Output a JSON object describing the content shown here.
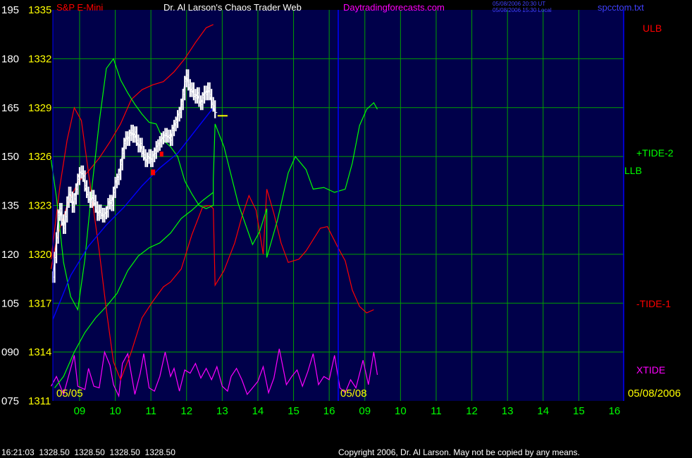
{
  "header": {
    "instrument": "S&P E-Mini",
    "title": "Dr. Al Larson's Chaos Trader Web",
    "site": "Daytradingforecasts.com",
    "timestamp_ut": "05/08/2006 20:30 UT",
    "timestamp_local": "05/08/2006 15:30 Local",
    "file": "spcctom.txt"
  },
  "footer": {
    "readout": "16:21:03  1328.50  1328.50  1328.50  1328.50",
    "copyright": "Copyright 2006, Dr. Al Larson. May not be copied by any means."
  },
  "colors": {
    "background": "#000000",
    "plot_bg": "#00004a",
    "grid": "#00a000",
    "price_axis": "#ffff00",
    "left_axis": "#ffffff",
    "hour_labels": "#00ff00",
    "date_labels": "#ffff00",
    "title": "#ffffff",
    "site": "#ff00ff",
    "instrument": "#ff0000",
    "file": "#4040ff",
    "ulb": "#ff0000",
    "llb": "#00ff00",
    "tide_plus": "#00ff00",
    "tide_minus": "#ff0000",
    "xtide": "#ff00ff",
    "ma": "#0000ff",
    "price_bars": "#ffffff",
    "divider": "#0000ff"
  },
  "chart_data": {
    "type": "line",
    "left_axis_ticks": [
      "195",
      "180",
      "165",
      "150",
      "135",
      "120",
      "105",
      "090",
      "075"
    ],
    "price_axis_ticks": [
      "1335",
      "1332",
      "1329",
      "1326",
      "1323",
      "1320",
      "1317",
      "1314",
      "1311"
    ],
    "x_hour_labels": [
      "09",
      "10",
      "11",
      "12",
      "13",
      "14",
      "15",
      "16",
      "09",
      "10",
      "11",
      "12",
      "13",
      "14",
      "15",
      "16"
    ],
    "date_labels": [
      "05/05",
      "05/08",
      "05/08/2006"
    ],
    "price_ylim": [
      1311,
      1335
    ],
    "series_labels": {
      "ulb": "ULB",
      "llb": "LLB",
      "tide_plus": "+TIDE-2",
      "tide_minus": "-TIDE-1",
      "xtide": "XTIDE"
    },
    "price_line": [
      [
        0,
        1318.6
      ],
      [
        0.05,
        1319.8
      ],
      [
        0.1,
        1321.0
      ],
      [
        0.15,
        1322.4
      ],
      [
        0.2,
        1322.8
      ],
      [
        0.25,
        1322.1
      ],
      [
        0.3,
        1321.6
      ],
      [
        0.35,
        1322.3
      ],
      [
        0.4,
        1323.2
      ],
      [
        0.45,
        1323.8
      ],
      [
        0.5,
        1323.5
      ],
      [
        0.55,
        1322.9
      ],
      [
        0.6,
        1323.4
      ],
      [
        0.65,
        1324.0
      ],
      [
        0.7,
        1324.6
      ],
      [
        0.75,
        1325.0
      ],
      [
        0.8,
        1325.1
      ],
      [
        0.85,
        1324.8
      ],
      [
        0.9,
        1324.2
      ],
      [
        0.95,
        1323.8
      ],
      [
        1.0,
        1323.5
      ],
      [
        1.05,
        1323.2
      ],
      [
        1.1,
        1323.6
      ],
      [
        1.15,
        1323.3
      ],
      [
        1.2,
        1322.9
      ],
      [
        1.25,
        1322.4
      ],
      [
        1.3,
        1322.7
      ],
      [
        1.35,
        1322.5
      ],
      [
        1.4,
        1322.3
      ],
      [
        1.45,
        1322.5
      ],
      [
        1.5,
        1322.6
      ],
      [
        1.55,
        1323.1
      ],
      [
        1.6,
        1323.3
      ],
      [
        1.65,
        1323.0
      ],
      [
        1.7,
        1323.8
      ],
      [
        1.75,
        1324.4
      ],
      [
        1.8,
        1324.6
      ],
      [
        1.85,
        1324.9
      ],
      [
        1.9,
        1325.5
      ],
      [
        1.95,
        1326.2
      ],
      [
        2.0,
        1326.8
      ],
      [
        2.05,
        1327.2
      ],
      [
        2.1,
        1327.0
      ],
      [
        2.15,
        1327.3
      ],
      [
        2.2,
        1327.6
      ],
      [
        2.25,
        1327.2
      ],
      [
        2.3,
        1327.5
      ],
      [
        2.35,
        1327.0
      ],
      [
        2.4,
        1326.6
      ],
      [
        2.45,
        1326.8
      ],
      [
        2.5,
        1326.3
      ],
      [
        2.55,
        1326.1
      ],
      [
        2.6,
        1325.7
      ],
      [
        2.65,
        1325.9
      ],
      [
        2.7,
        1326.1
      ],
      [
        2.75,
        1325.7
      ],
      [
        2.8,
        1326.0
      ],
      [
        2.85,
        1326.2
      ],
      [
        2.9,
        1326.6
      ],
      [
        2.95,
        1326.7
      ],
      [
        3.0,
        1326.9
      ],
      [
        3.05,
        1327.1
      ],
      [
        3.1,
        1327.2
      ],
      [
        3.15,
        1327.4
      ],
      [
        3.2,
        1327.2
      ],
      [
        3.25,
        1327.3
      ],
      [
        3.3,
        1327.0
      ],
      [
        3.35,
        1327.6
      ],
      [
        3.4,
        1327.9
      ],
      [
        3.45,
        1328.1
      ],
      [
        3.5,
        1328.5
      ],
      [
        3.55,
        1328.7
      ],
      [
        3.6,
        1329.2
      ],
      [
        3.65,
        1329.8
      ],
      [
        3.7,
        1330.6
      ],
      [
        3.75,
        1331.0
      ],
      [
        3.8,
        1330.4
      ],
      [
        3.85,
        1330.0
      ],
      [
        3.9,
        1330.2
      ],
      [
        3.95,
        1329.8
      ],
      [
        4.0,
        1329.6
      ],
      [
        4.05,
        1329.9
      ],
      [
        4.1,
        1329.4
      ],
      [
        4.15,
        1329.2
      ],
      [
        4.2,
        1329.6
      ],
      [
        4.25,
        1330.0
      ],
      [
        4.3,
        1329.8
      ],
      [
        4.35,
        1330.2
      ],
      [
        4.4,
        1329.8
      ],
      [
        4.45,
        1329.3
      ],
      [
        4.5,
        1329.1
      ],
      [
        4.55,
        1328.7
      ]
    ],
    "ma_line": [
      [
        0,
        1316.0
      ],
      [
        0.5,
        1318.7
      ],
      [
        1.0,
        1320.5
      ],
      [
        1.5,
        1321.8
      ],
      [
        2.0,
        1322.9
      ],
      [
        2.5,
        1324.2
      ],
      [
        3.0,
        1325.3
      ],
      [
        3.5,
        1326.2
      ],
      [
        4.0,
        1327.6
      ],
      [
        4.5,
        1329.0
      ]
    ],
    "ulb": [
      [
        -0.05,
        1319.1
      ],
      [
        0.1,
        1320.9
      ],
      [
        0.4,
        1323.0
      ],
      [
        0.7,
        1324.4
      ],
      [
        1.0,
        1325.1
      ],
      [
        1.3,
        1325.9
      ],
      [
        1.6,
        1326.9
      ],
      [
        1.9,
        1328.0
      ],
      [
        2.2,
        1329.5
      ],
      [
        2.5,
        1330.1
      ],
      [
        2.8,
        1330.4
      ],
      [
        3.1,
        1330.6
      ],
      [
        3.4,
        1331.2
      ],
      [
        3.7,
        1332.0
      ],
      [
        4.0,
        1333.0
      ],
      [
        4.3,
        1333.9
      ],
      [
        4.5,
        1334.1
      ]
    ],
    "llb": [
      [
        0.05,
        1311.8
      ],
      [
        0.3,
        1312.5
      ],
      [
        0.6,
        1314.0
      ],
      [
        0.9,
        1315.2
      ],
      [
        1.2,
        1316.1
      ],
      [
        1.5,
        1316.8
      ],
      [
        1.8,
        1317.6
      ],
      [
        2.1,
        1319.0
      ],
      [
        2.4,
        1319.9
      ],
      [
        2.7,
        1320.4
      ],
      [
        3.0,
        1320.7
      ],
      [
        3.3,
        1321.3
      ],
      [
        3.6,
        1322.2
      ],
      [
        3.9,
        1322.7
      ],
      [
        4.2,
        1323.3
      ],
      [
        4.5,
        1323.8
      ]
    ],
    "tide_plus": [
      [
        -0.05,
        1325.8
      ],
      [
        0.1,
        1323.5
      ],
      [
        0.3,
        1319.5
      ],
      [
        0.5,
        1317.4
      ],
      [
        0.7,
        1316.6
      ],
      [
        0.9,
        1319.7
      ],
      [
        1.1,
        1324.2
      ],
      [
        1.3,
        1328.1
      ],
      [
        1.5,
        1331.4
      ],
      [
        1.7,
        1332.0
      ],
      [
        1.9,
        1330.7
      ],
      [
        2.1,
        1329.9
      ],
      [
        2.3,
        1329.2
      ],
      [
        2.5,
        1328.6
      ],
      [
        2.7,
        1328.1
      ],
      [
        2.9,
        1328.0
      ],
      [
        3.1,
        1327.0
      ],
      [
        3.3,
        1326.6
      ],
      [
        3.5,
        1326.0
      ],
      [
        3.7,
        1324.5
      ],
      [
        3.9,
        1323.7
      ],
      [
        4.1,
        1323.0
      ],
      [
        4.3,
        1322.8
      ],
      [
        4.5,
        1323.0
      ],
      [
        4.5,
        1324.6
      ],
      [
        4.55,
        1328.0
      ],
      [
        4.8,
        1326.6
      ],
      [
        5.2,
        1323.1
      ],
      [
        5.6,
        1320.6
      ],
      [
        5.8,
        1321.4
      ],
      [
        6.0,
        1322.8
      ],
      [
        6.0,
        1319.8
      ],
      [
        6.3,
        1322.1
      ],
      [
        6.6,
        1325.0
      ],
      [
        6.8,
        1326.0
      ],
      [
        7.1,
        1325.2
      ],
      [
        7.3,
        1324.0
      ],
      [
        7.6,
        1324.1
      ],
      [
        7.9,
        1323.8
      ],
      [
        8.2,
        1324.0
      ],
      [
        8.4,
        1325.6
      ],
      [
        8.6,
        1327.9
      ],
      [
        8.8,
        1328.9
      ],
      [
        9.0,
        1329.3
      ],
      [
        9.1,
        1328.9
      ]
    ],
    "tide_minus": [
      [
        -0.05,
        1319.7
      ],
      [
        0.2,
        1324.2
      ],
      [
        0.4,
        1327.0
      ],
      [
        0.6,
        1329.0
      ],
      [
        0.8,
        1328.2
      ],
      [
        1.0,
        1325.0
      ],
      [
        1.3,
        1320.2
      ],
      [
        1.5,
        1316.6
      ],
      [
        1.7,
        1313.4
      ],
      [
        1.9,
        1312.3
      ],
      [
        2.2,
        1314.0
      ],
      [
        2.5,
        1316.1
      ],
      [
        2.8,
        1317.1
      ],
      [
        3.1,
        1318.0
      ],
      [
        3.3,
        1318.3
      ],
      [
        3.6,
        1319.1
      ],
      [
        3.9,
        1321.2
      ],
      [
        4.2,
        1322.9
      ],
      [
        4.4,
        1323.0
      ],
      [
        4.5,
        1322.8
      ],
      [
        4.55,
        1318.1
      ],
      [
        4.8,
        1319.0
      ],
      [
        5.1,
        1320.7
      ],
      [
        5.3,
        1322.3
      ],
      [
        5.5,
        1323.6
      ],
      [
        5.7,
        1322.7
      ],
      [
        5.9,
        1320.0
      ],
      [
        6.0,
        1324.0
      ],
      [
        6.2,
        1322.5
      ],
      [
        6.4,
        1320.7
      ],
      [
        6.6,
        1319.5
      ],
      [
        6.9,
        1319.7
      ],
      [
        7.1,
        1320.2
      ],
      [
        7.3,
        1320.9
      ],
      [
        7.5,
        1321.6
      ],
      [
        7.7,
        1321.7
      ],
      [
        8.0,
        1320.4
      ],
      [
        8.2,
        1319.6
      ],
      [
        8.4,
        1317.8
      ],
      [
        8.6,
        1316.8
      ],
      [
        8.8,
        1316.4
      ],
      [
        9.0,
        1316.6
      ]
    ],
    "xtide": [
      [
        -0.05,
        1311.9
      ],
      [
        0.1,
        1312.5
      ],
      [
        0.3,
        1311.4
      ],
      [
        0.5,
        1313.0
      ],
      [
        0.6,
        1313.8
      ],
      [
        0.7,
        1311.9
      ],
      [
        0.9,
        1311.7
      ],
      [
        1.0,
        1313.0
      ],
      [
        1.15,
        1311.9
      ],
      [
        1.3,
        1311.8
      ],
      [
        1.45,
        1314.0
      ],
      [
        1.6,
        1313.2
      ],
      [
        1.7,
        1312.0
      ],
      [
        1.85,
        1311.3
      ],
      [
        1.95,
        1313.3
      ],
      [
        2.1,
        1313.9
      ],
      [
        2.3,
        1311.4
      ],
      [
        2.45,
        1312.7
      ],
      [
        2.55,
        1313.9
      ],
      [
        2.7,
        1311.8
      ],
      [
        2.85,
        1311.6
      ],
      [
        3.0,
        1312.5
      ],
      [
        3.15,
        1314.0
      ],
      [
        3.3,
        1312.5
      ],
      [
        3.4,
        1313.0
      ],
      [
        3.55,
        1311.6
      ],
      [
        3.7,
        1312.9
      ],
      [
        3.85,
        1312.7
      ],
      [
        4.0,
        1313.3
      ],
      [
        4.15,
        1312.4
      ],
      [
        4.3,
        1313.0
      ],
      [
        4.45,
        1312.3
      ],
      [
        4.6,
        1313.1
      ],
      [
        4.75,
        1311.9
      ],
      [
        4.9,
        1311.6
      ],
      [
        5.0,
        1312.5
      ],
      [
        5.15,
        1313.0
      ],
      [
        5.3,
        1312.3
      ],
      [
        5.45,
        1311.4
      ],
      [
        5.6,
        1311.8
      ],
      [
        5.75,
        1312.2
      ],
      [
        5.9,
        1313.1
      ],
      [
        6.05,
        1311.5
      ],
      [
        6.2,
        1312.4
      ],
      [
        6.35,
        1314.2
      ],
      [
        6.55,
        1312.0
      ],
      [
        6.7,
        1312.5
      ],
      [
        6.85,
        1312.9
      ],
      [
        7.0,
        1311.9
      ],
      [
        7.15,
        1312.8
      ],
      [
        7.3,
        1313.9
      ],
      [
        7.45,
        1312.0
      ],
      [
        7.6,
        1312.5
      ],
      [
        7.75,
        1312.3
      ],
      [
        7.9,
        1313.8
      ],
      [
        8.05,
        1311.8
      ],
      [
        8.2,
        1311.5
      ],
      [
        8.35,
        1312.3
      ],
      [
        8.5,
        1311.8
      ],
      [
        8.7,
        1313.5
      ],
      [
        8.85,
        1312.0
      ],
      [
        9.0,
        1314.0
      ],
      [
        9.1,
        1312.6
      ]
    ],
    "marker_value": 1328.5
  }
}
